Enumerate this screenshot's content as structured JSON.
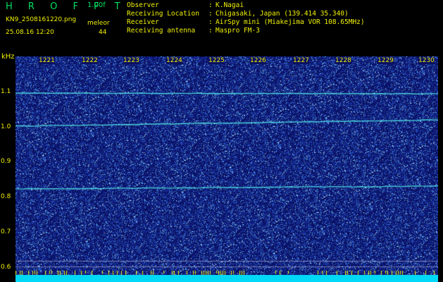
{
  "header": {
    "title": "H R O F F T",
    "version": "1.00f",
    "filename": "KN9_2508161220.png",
    "datetime": "25.08.16 12:20",
    "mode": "meleor",
    "count": "44"
  },
  "info": [
    {
      "label": "Observer",
      "value": "K.Nagai"
    },
    {
      "label": "Receiving Location",
      "value": "Chigasaki, Japan (139.414 35.340)"
    },
    {
      "label": "Receiver",
      "value": "AirSpy mini (Miakejima VOR 108.65MHz)"
    },
    {
      "label": "Receiving antenna",
      "value": "Maspro FM-3"
    }
  ],
  "y_axis": {
    "unit": "kHz",
    "ticks": [
      "1.1",
      "1.0",
      "0.9",
      "0.8",
      "0.7",
      "0.6"
    ]
  },
  "x_axis": {
    "ticks": [
      "1221",
      "1222",
      "1223",
      "1224",
      "1225",
      "1226",
      "1227",
      "1228",
      "1229",
      "1230"
    ]
  },
  "colors": {
    "background": "#000000",
    "plot": "#0a1060",
    "label": "#f0f000",
    "title": "#00e060",
    "signal": "#40e0e0",
    "bottom_bar": "#00d8f8"
  }
}
